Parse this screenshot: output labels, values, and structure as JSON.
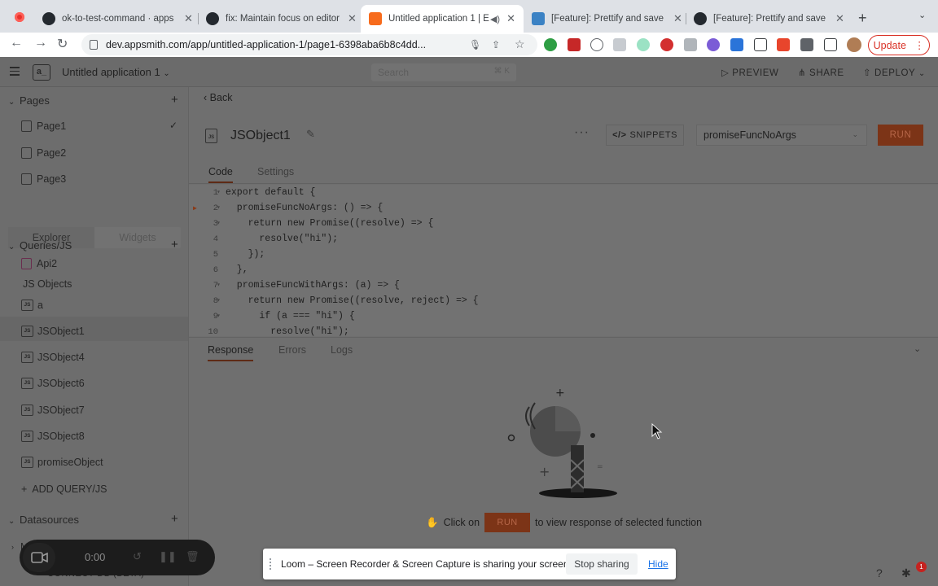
{
  "browser": {
    "tabs": [
      {
        "title": "ok-to-test-command · apps"
      },
      {
        "title": "fix: Maintain focus on editor"
      },
      {
        "title": "Untitled application 1 | E"
      },
      {
        "title": "[Feature]: Prettify and save"
      },
      {
        "title": "[Feature]: Prettify and save"
      }
    ],
    "url": "dev.appsmith.com/app/untitled-application-1/page1-6398aba6b8c4dd...",
    "update_label": "Update"
  },
  "app": {
    "name": "Untitled application 1",
    "search_placeholder": "Search",
    "search_shortcut": "⌘ K",
    "preview_label": "PREVIEW",
    "share_label": "SHARE",
    "deploy_label": "DEPLOY"
  },
  "sidebar": {
    "pages_title": "Pages",
    "pages": [
      {
        "label": "Page1"
      },
      {
        "label": "Page2"
      },
      {
        "label": "Page3"
      }
    ],
    "toggle": {
      "explorer": "Explorer",
      "widgets": "Widgets"
    },
    "queries_title": "Queries/JS",
    "api_item": "Api2",
    "js_group": "JS Objects",
    "js_items": [
      {
        "label": "a"
      },
      {
        "label": "JSObject1"
      },
      {
        "label": "JSObject4"
      },
      {
        "label": "JSObject6"
      },
      {
        "label": "JSObject7"
      },
      {
        "label": "JSObject8"
      },
      {
        "label": "promiseObject"
      }
    ],
    "add_label": "ADD QUERY/JS",
    "datasources_title": "Datasources",
    "datasource_item": "Mo...o",
    "connect_label": "CONNECT DB (BETA)"
  },
  "editor": {
    "back_label": "Back",
    "object_name": "JSObject1",
    "snippets_label": "SNIPPETS",
    "selected_function": "promiseFuncNoArgs",
    "run_label": "RUN",
    "tabs": [
      "Code",
      "Settings"
    ],
    "code_lines": [
      {
        "n": "1",
        "text": "export default {"
      },
      {
        "n": "2",
        "text": "  promiseFuncNoArgs: () => {"
      },
      {
        "n": "3",
        "text": "    return new Promise((resolve) => {"
      },
      {
        "n": "4",
        "text": "      resolve(\"hi\");"
      },
      {
        "n": "5",
        "text": "    });"
      },
      {
        "n": "6",
        "text": "  },"
      },
      {
        "n": "7",
        "text": "  promiseFuncWithArgs: (a) => {"
      },
      {
        "n": "8",
        "text": "    return new Promise((resolve, reject) => {"
      },
      {
        "n": "9",
        "text": "      if (a === \"hi\") {"
      },
      {
        "n": "10",
        "text": "        resolve(\"hi\");"
      }
    ]
  },
  "response": {
    "tabs": [
      "Response",
      "Errors",
      "Logs"
    ],
    "hint_prefix": "Click on",
    "hint_run": "RUN",
    "hint_suffix": "to view response of selected function"
  },
  "loom": {
    "time": "0:00",
    "share_message": "Loom – Screen Recorder & Screen Capture is sharing your screen.",
    "stop_label": "Stop sharing",
    "hide_label": "Hide"
  },
  "notifications": {
    "count": "1"
  }
}
